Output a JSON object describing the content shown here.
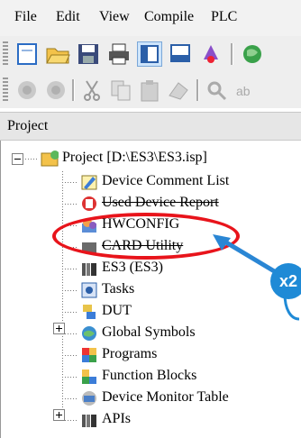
{
  "menu": {
    "items": [
      "File",
      "Edit",
      "View",
      "Compile",
      "PLC"
    ]
  },
  "panel": {
    "title": "Project"
  },
  "tree": {
    "root_label": "Project [D:\\ES3\\ES3.isp]",
    "items": [
      {
        "label": "Device Comment List",
        "icon": "comment-list-icon"
      },
      {
        "label": "Used Device Report",
        "icon": "device-report-icon"
      },
      {
        "label": "HWCONFIG",
        "icon": "hwconfig-icon"
      },
      {
        "label": "CARD Utility",
        "icon": "card-utility-icon"
      },
      {
        "label": "ES3  (ES3)",
        "icon": "plc-device-icon"
      },
      {
        "label": "Tasks",
        "icon": "tasks-icon"
      },
      {
        "label": "DUT",
        "icon": "dut-icon"
      },
      {
        "label": "Global Symbols",
        "icon": "global-symbols-icon"
      },
      {
        "label": "Programs",
        "icon": "programs-icon"
      },
      {
        "label": "Function Blocks",
        "icon": "function-blocks-icon"
      },
      {
        "label": "Device Monitor Table",
        "icon": "monitor-table-icon"
      },
      {
        "label": "APIs",
        "icon": "apis-icon"
      }
    ]
  },
  "callout": {
    "badge_text": "x2",
    "highlight_color": "#e8141b",
    "badge_color": "#1f8ad6"
  }
}
